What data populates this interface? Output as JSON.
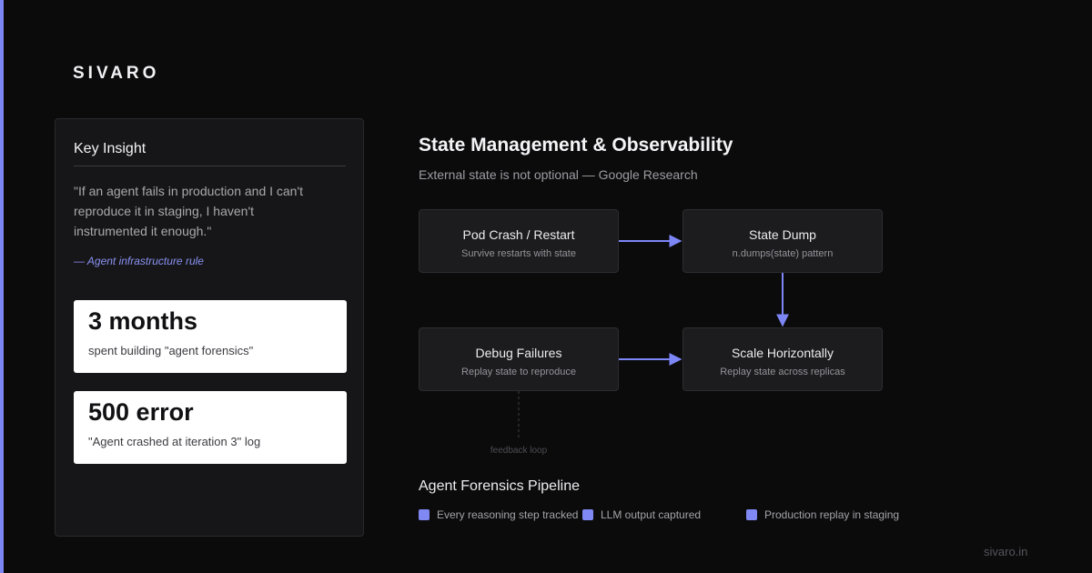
{
  "brand": {
    "name": "SIVARO",
    "footer_url": "sivaro.in"
  },
  "colors": {
    "accent": "#7c86f5",
    "background": "#0b0b0c",
    "card": "#1c1c1f",
    "stat_card": "#ffffff"
  },
  "insight": {
    "title": "Key Insight",
    "quote": "\"If an agent fails in production and I can't reproduce it in staging, I haven't instrumented it enough.\"",
    "attribution": "— Agent infrastructure rule",
    "stats": [
      {
        "value": "3 months",
        "label": "spent building \"agent forensics\""
      },
      {
        "value": "500 error",
        "label": "\"Agent crashed at iteration 3\" log"
      }
    ]
  },
  "diagram": {
    "title": "State Management & Observability",
    "subtitle": "External state is not optional — Google Research",
    "nodes": [
      {
        "title": "Pod Crash / Restart",
        "subtitle": "Survive restarts with state"
      },
      {
        "title": "State Dump",
        "subtitle": "n.dumps(state) pattern"
      },
      {
        "title": "Debug Failures",
        "subtitle": "Replay state to reproduce"
      },
      {
        "title": "Scale Horizontally",
        "subtitle": "Replay state across replicas"
      }
    ],
    "edges": [
      {
        "from": "Pod Crash / Restart",
        "to": "State Dump"
      },
      {
        "from": "State Dump",
        "to": "Scale Horizontally"
      },
      {
        "from": "Debug Failures",
        "to": "Scale Horizontally"
      }
    ],
    "feedback_label": "feedback loop"
  },
  "pipeline": {
    "title": "Agent Forensics Pipeline",
    "items": [
      {
        "label": "Every reasoning step tracked"
      },
      {
        "label": "LLM output captured"
      },
      {
        "label": "Production replay in staging"
      }
    ]
  }
}
